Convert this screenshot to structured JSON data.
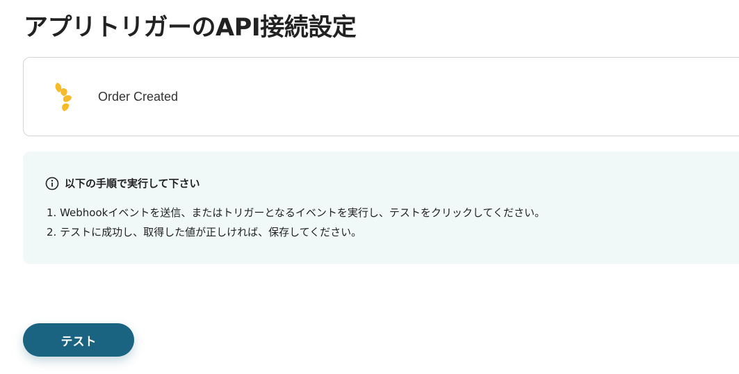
{
  "page": {
    "title": "アプリトリガーのAPI接続設定"
  },
  "trigger": {
    "icon": "app-logo-icon",
    "label": "Order Created"
  },
  "instructions": {
    "icon": "info-icon",
    "heading": "以下の手順で実行して下さい",
    "steps": [
      "1. Webhookイベントを送信、またはトリガーとなるイベントを実行し、テストをクリックしてください。",
      "2. テストに成功し、取得した値が正しければ、保存してください。"
    ]
  },
  "actions": {
    "test_label": "テスト"
  },
  "colors": {
    "primary_button": "#1a6482",
    "info_background": "#f1f8f8",
    "logo_yellow": "#f7bb2a"
  }
}
